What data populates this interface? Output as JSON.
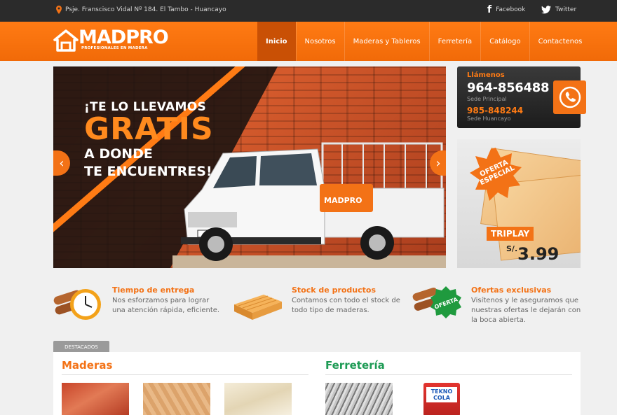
{
  "topbar": {
    "address": "Psje. Franscisco Vidal Nº 184. El Tambo - Huancayo",
    "facebook_label": "Facebook",
    "twitter_label": "Twitter"
  },
  "brand": {
    "name_mad": "MAD",
    "name_pro": "PRO",
    "tagline": "PROFESIONALES EN MADERA"
  },
  "nav": {
    "items": [
      {
        "label": "Inicio",
        "active": true
      },
      {
        "label": "Nosotros"
      },
      {
        "label": "Maderas y Tableros"
      },
      {
        "label": "Ferretería"
      },
      {
        "label": "Catálogo"
      },
      {
        "label": "Contactenos"
      }
    ]
  },
  "hero": {
    "line1": "¡TE LO LLEVAMOS",
    "line2": "GRATIS",
    "line3": "A DONDE",
    "line4": "TE ENCUENTRES!",
    "truck_brand": "MADPRO",
    "prev_icon": "chevron-left-icon",
    "next_icon": "chevron-right-icon"
  },
  "call": {
    "title": "Llámenos",
    "main_number": "964-856488",
    "main_label": "Sede Principal",
    "second_number": "985-848244",
    "second_label": "Sede Huancayo",
    "icon": "phone-icon"
  },
  "offer": {
    "burst_line1": "OFERTA",
    "burst_line2": "ESPECIAL",
    "product": "TRIPLAY",
    "currency": "S/.",
    "price": "3.99"
  },
  "features": [
    {
      "title": "Tiempo de entrega",
      "description": "Nos esforzamos para lograr una atención rápida, eficiente.",
      "icon": "clock-wood-icon"
    },
    {
      "title": "Stock de productos",
      "description": "Contamos con todo el stock de todo tipo de maderas.",
      "icon": "wood-planks-icon"
    },
    {
      "title": "Ofertas exclusivas",
      "description": "Visítenos y le aseguramos que nuestras ofertas le dejarán con la boca abierta.",
      "icon": "offer-badge-icon",
      "badge": "OFERTA"
    }
  ],
  "featured": {
    "tab_label": "DESTACADOS",
    "columns": [
      {
        "title": "Maderas"
      },
      {
        "title": "Ferretería"
      }
    ],
    "product_label": "TEKNO COLA"
  },
  "colors": {
    "accent": "#f37216",
    "topbar": "#2b2b2b",
    "green_title": "#1e9b55"
  }
}
